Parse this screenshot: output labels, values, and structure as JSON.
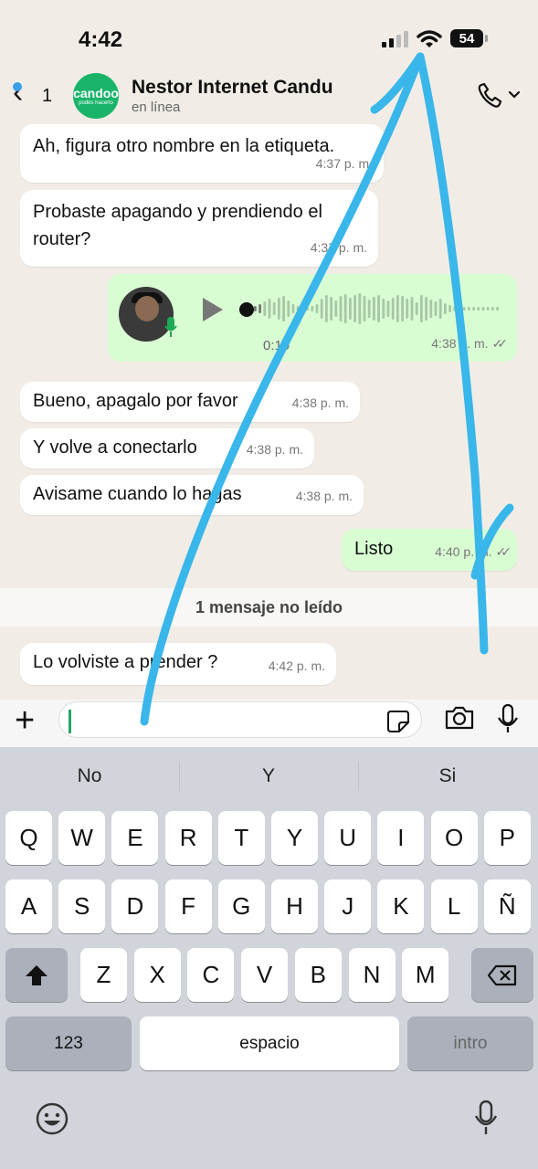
{
  "status_bar": {
    "time": "4:42",
    "battery": "54"
  },
  "header": {
    "unread_count": "1",
    "avatar_brand": "candoo",
    "avatar_tagline": "podés hacerlo",
    "contact_name": "Nestor Internet Candu",
    "contact_status": "en línea"
  },
  "messages": [
    {
      "dir": "in",
      "text": "Ah, figura otro nombre en la etiqueta.",
      "time": "4:37 p. m."
    },
    {
      "dir": "in",
      "text": "Probaste apagando y prendiendo el router?",
      "time": "4:37 p. m."
    },
    {
      "dir": "out",
      "type": "voice",
      "duration": "0:19",
      "time": "4:38 p. m.",
      "ticks": "✓✓"
    },
    {
      "dir": "in",
      "text": "Bueno, apagalo por favor",
      "time": "4:38 p. m."
    },
    {
      "dir": "in",
      "text": "Y volve a conectarlo",
      "time": "4:38 p. m."
    },
    {
      "dir": "in",
      "text": "Avisame cuando lo hagas",
      "time": "4:38 p. m."
    },
    {
      "dir": "out",
      "text": "Listo",
      "time": "4:40 p. m.",
      "ticks": "✓✓"
    },
    {
      "dir": "in",
      "text": "Lo volviste a prender ?",
      "time": "4:42 p. m."
    }
  ],
  "unread_divider": "1 mensaje no leído",
  "keyboard": {
    "suggestions": [
      "No",
      "Y",
      "Si"
    ],
    "row1": [
      "Q",
      "W",
      "E",
      "R",
      "T",
      "Y",
      "U",
      "I",
      "O",
      "P"
    ],
    "row2": [
      "A",
      "S",
      "D",
      "F",
      "G",
      "H",
      "J",
      "K",
      "L",
      "Ñ"
    ],
    "row3": [
      "Z",
      "X",
      "C",
      "V",
      "B",
      "N",
      "M"
    ],
    "numbers_key": "123",
    "space_key": "espacio",
    "return_key": "intro"
  },
  "colors": {
    "outgoing_bubble": "#d9fdd3",
    "annotation_stroke": "#39b6ea",
    "accent_green": "#25a567"
  }
}
